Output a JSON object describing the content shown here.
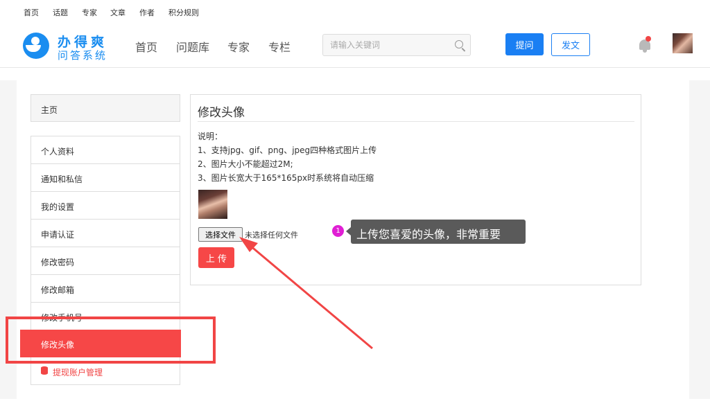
{
  "topnav": [
    "首页",
    "话题",
    "专家",
    "文章",
    "作者",
    "积分规则"
  ],
  "header": {
    "logo_name": "办得爽",
    "logo_sub": "问答系统",
    "nav": [
      "首页",
      "问题库",
      "专家",
      "专栏"
    ],
    "search_placeholder": "请输入关键词",
    "ask_label": "提问",
    "post_label": "发文"
  },
  "sidebar": {
    "home": "主页",
    "items": [
      "个人资料",
      "通知和私信",
      "我的设置",
      "申请认证",
      "修改密码",
      "修改邮箱",
      "修改手机号",
      "修改头像",
      "提现账户管理"
    ],
    "active_index": 7
  },
  "main": {
    "title": "修改头像",
    "desc": [
      "说明：",
      "1、支持jpg、gif、png、jpeg四种格式图片上传",
      "2、图片大小不能超过2M;",
      "3、图片长宽大于165*165px时系统将自动压缩"
    ],
    "file_button": "选择文件",
    "file_status": "未选择任何文件",
    "upload_label": "上 传"
  },
  "annotation": {
    "step": "1",
    "tip": "上传您喜爱的头像，非常重要"
  },
  "colors": {
    "brand": "#1a8df0",
    "accent_red": "#f64747",
    "step_badge": "#e01fd4"
  }
}
